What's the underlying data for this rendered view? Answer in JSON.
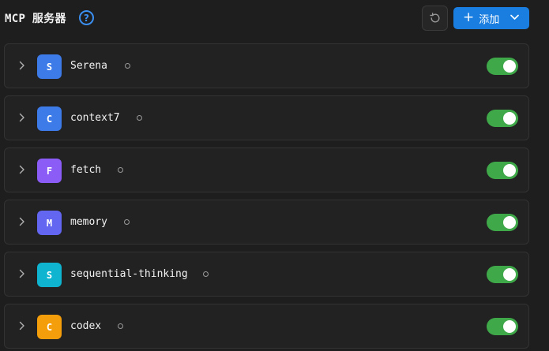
{
  "header": {
    "title": "MCP 服务器",
    "help_icon": "question-circle-icon",
    "add_label": "添加",
    "accent": "#1a7ee0"
  },
  "servers": [
    {
      "name": "Serena",
      "initial": "S",
      "color": "#3d7be8",
      "enabled": true
    },
    {
      "name": "context7",
      "initial": "C",
      "color": "#3d7be8",
      "enabled": true
    },
    {
      "name": "fetch",
      "initial": "F",
      "color": "#8b5cf6",
      "enabled": true
    },
    {
      "name": "memory",
      "initial": "M",
      "color": "#6366f1",
      "enabled": true
    },
    {
      "name": "sequential-thinking",
      "initial": "S",
      "color": "#0fb5d0",
      "enabled": true
    },
    {
      "name": "codex",
      "initial": "C",
      "color": "#f59e0b",
      "enabled": true
    }
  ]
}
